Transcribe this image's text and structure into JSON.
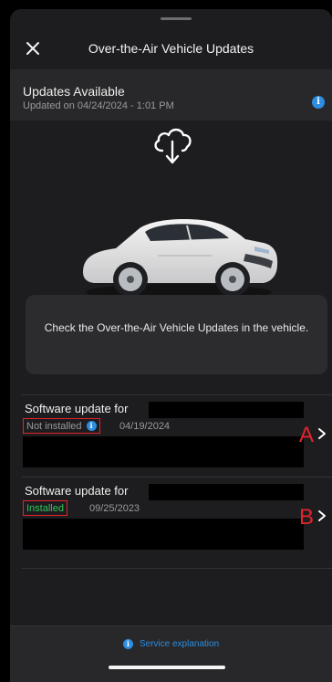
{
  "header": {
    "title": "Over-the-Air Vehicle Updates",
    "close_icon": "close-icon"
  },
  "status_panel": {
    "title": "Updates Available",
    "subtitle": "Updated on 04/24/2024 - 1:01 PM",
    "info_icon": "info-icon",
    "info_glyph": "i"
  },
  "hero": {
    "cloud_icon": "cloud-download-icon",
    "car_image": "vehicle-image"
  },
  "notice": {
    "text": "Check the Over-the-Air Vehicle Updates in the vehicle."
  },
  "updates": [
    {
      "title": "Software update for",
      "status": "Not installed",
      "status_color": "#9a9a9c",
      "date": "04/19/2024",
      "marker": "A"
    },
    {
      "title": "Software update for",
      "status": "Installed",
      "status_color": "#2fc75a",
      "date": "09/25/2023",
      "marker": "B"
    }
  ],
  "footer": {
    "service_link": "Service explanation",
    "info_glyph": "i"
  },
  "colors": {
    "accent_blue": "#2d8de0",
    "marker_red": "#e3242b",
    "installed_green": "#2fc75a"
  }
}
